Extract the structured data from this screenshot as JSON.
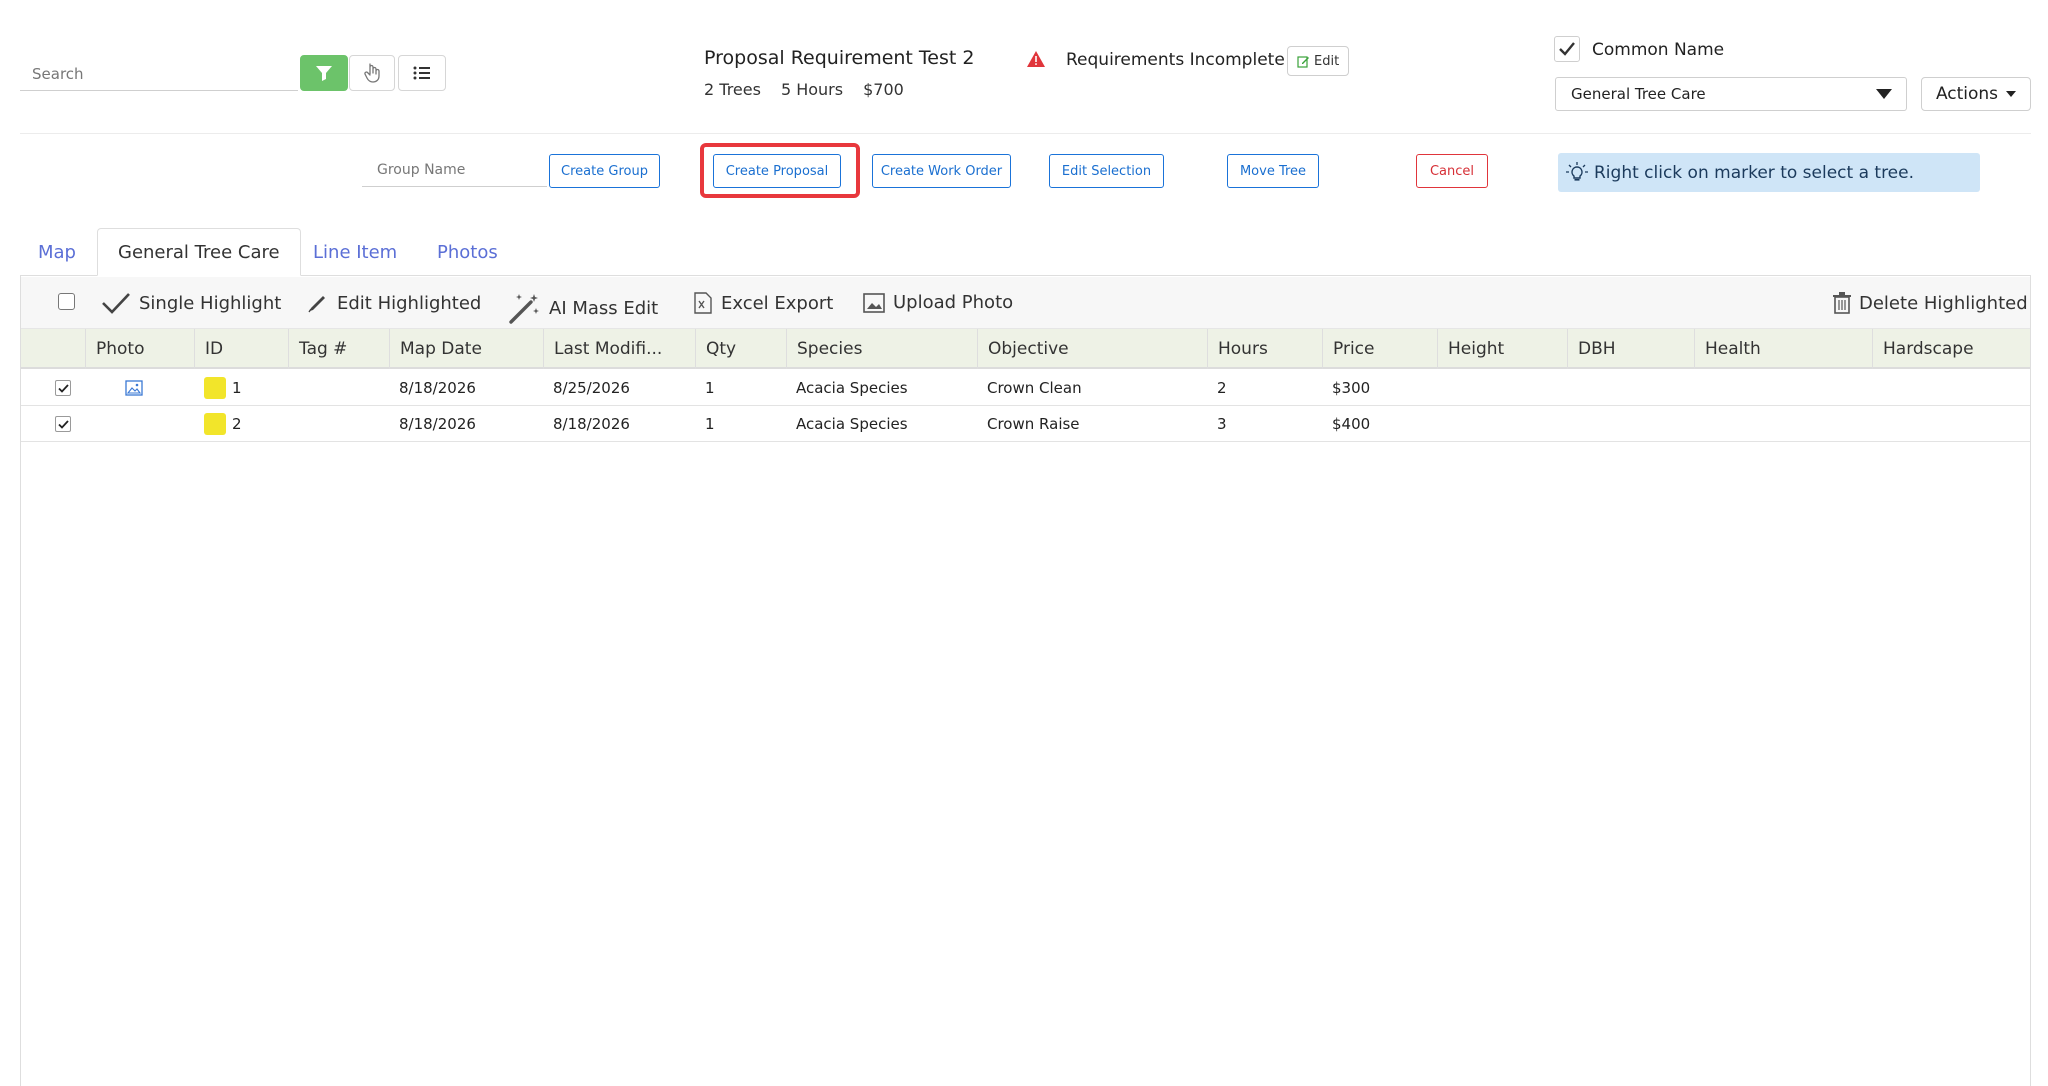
{
  "search": {
    "placeholder": "Search"
  },
  "project": {
    "title": "Proposal Requirement Test 2",
    "trees": "2 Trees",
    "hours": "5 Hours",
    "price": "$700",
    "requirements_status": "Requirements Incomplete",
    "edit_label": "Edit"
  },
  "common_name": {
    "label": "Common Name",
    "checked": true
  },
  "service_select": {
    "value": "General Tree Care"
  },
  "actions_label": "Actions",
  "action_row": {
    "group_placeholder": "Group Name",
    "create_group": "Create Group",
    "create_proposal": "Create Proposal",
    "create_work_order": "Create Work Order",
    "edit_selection": "Edit Selection",
    "move_tree": "Move Tree",
    "cancel": "Cancel",
    "hint": "Right click on marker to select a tree."
  },
  "tabs": [
    {
      "label": "Map"
    },
    {
      "label": "General Tree Care"
    },
    {
      "label": "Line Item"
    },
    {
      "label": "Photos"
    }
  ],
  "toolbar": {
    "single_highlight": "Single Highlight",
    "edit_highlighted": "Edit Highlighted",
    "ai_mass_edit": "AI Mass Edit",
    "excel_export": "Excel Export",
    "upload_photo": "Upload Photo",
    "delete_highlighted": "Delete Highlighted"
  },
  "table": {
    "columns": [
      "Photo",
      "ID",
      "Tag #",
      "Map Date",
      "Last Modifi...",
      "Qty",
      "Species",
      "Objective",
      "Hours",
      "Price",
      "Height",
      "DBH",
      "Health",
      "Hardscape"
    ],
    "rows": [
      {
        "id": "1",
        "tag": "",
        "map_date": "8/18/2026",
        "last_modified": "8/25/2026",
        "qty": "1",
        "species": "Acacia Species",
        "objective": "Crown Clean",
        "hours": "2",
        "price": "$300"
      },
      {
        "id": "2",
        "tag": "",
        "map_date": "8/18/2026",
        "last_modified": "8/18/2026",
        "qty": "1",
        "species": "Acacia Species",
        "objective": "Crown Raise",
        "hours": "3",
        "price": "$400"
      }
    ]
  },
  "colors": {
    "accent_blue": "#1a73d9",
    "filter_green": "#6cc36a",
    "danger_red": "#e0353b",
    "hint_bg": "#cfe5f7",
    "tree_swatch": "#f2e52a"
  }
}
